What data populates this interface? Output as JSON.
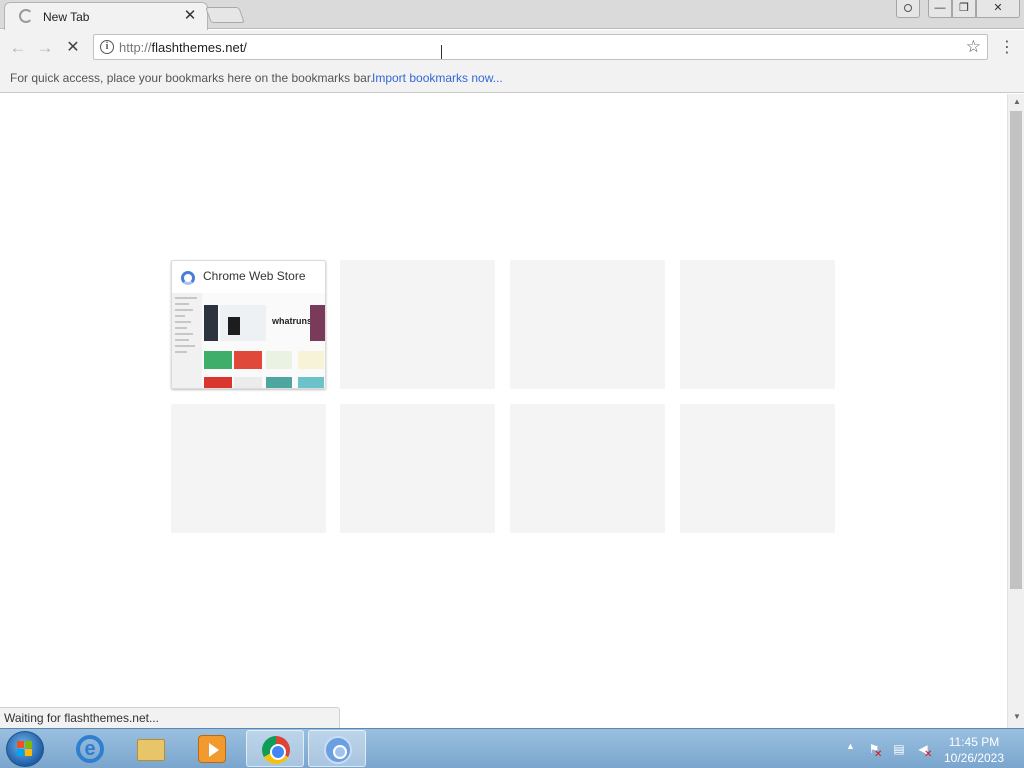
{
  "tab": {
    "title": "New Tab",
    "close_glyph": "✕"
  },
  "window_controls": {
    "minimize": "—",
    "maximize": "❐",
    "close": "✕"
  },
  "toolbar": {
    "back_glyph": "←",
    "forward_glyph": "→",
    "stop_glyph": "✕",
    "url_scheme": "http://",
    "url_host": "flashthemes.net/",
    "info_glyph": "i",
    "star_glyph": "☆",
    "menu_glyph": "⋮"
  },
  "bookmarks_bar": {
    "hint": "For quick access, place your bookmarks here on the bookmarks bar.",
    "import_link": "Import bookmarks now..."
  },
  "most_visited": [
    {
      "title": "Chrome Web Store",
      "thumbnail_logo": "whatruns"
    }
  ],
  "status_bubble": "Waiting for flashthemes.net...",
  "taskbar": {
    "items": [
      "internet-explorer",
      "windows-explorer",
      "media-player",
      "google-chrome",
      "chromium"
    ]
  },
  "tray": {
    "show_hidden": "▲"
  },
  "clock": {
    "time": "11:45 PM",
    "date": "10/26/2023"
  },
  "colors": {
    "link": "#3367d6",
    "taskbar": "#7aa5cd"
  }
}
